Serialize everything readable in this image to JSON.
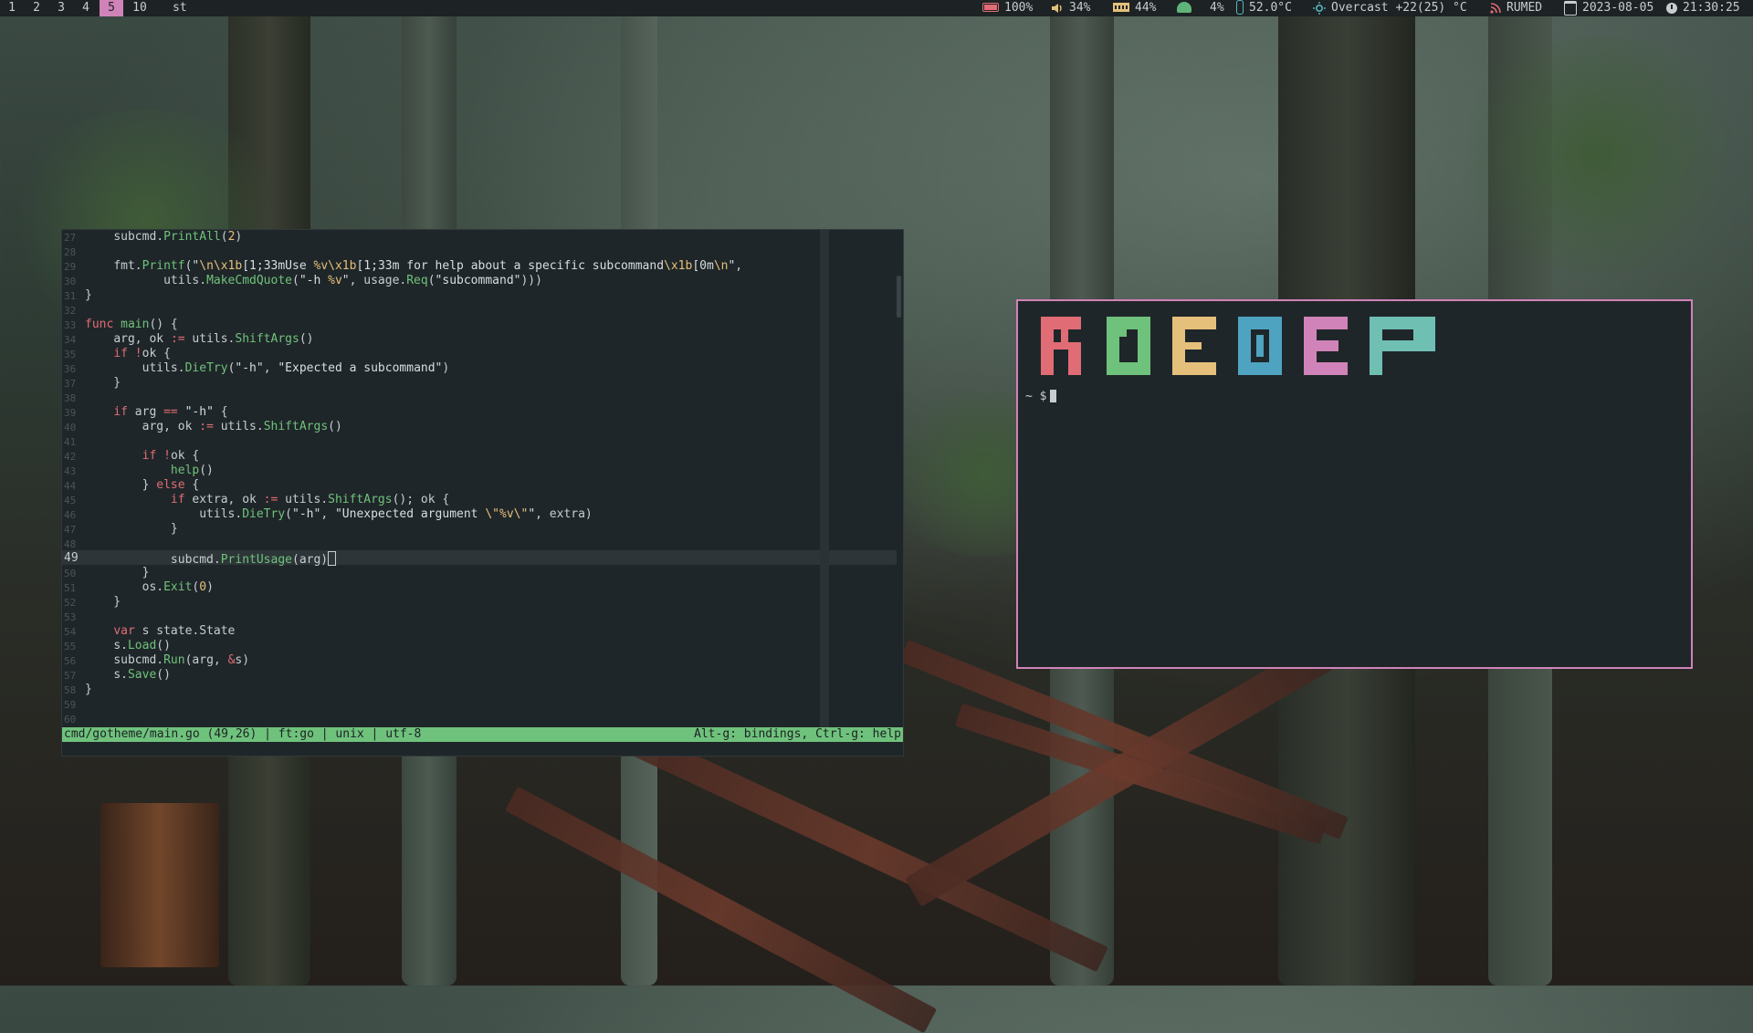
{
  "topbar": {
    "workspaces": [
      "1",
      "2",
      "3",
      "4",
      "5",
      "10"
    ],
    "active_workspace": "5",
    "window_title": "st",
    "battery": "100%",
    "volume": "34%",
    "memory": "44%",
    "cpu": "4%",
    "temperature": "52.0°C",
    "weather": "Overcast +22(25) °C",
    "rss": "RUMED",
    "date": "2023-08-05",
    "time": "21:30:25"
  },
  "editor": {
    "line_numbers": [
      "27",
      "28",
      "29",
      "30",
      "31",
      "32",
      "33",
      "34",
      "35",
      "36",
      "37",
      "38",
      "39",
      "40",
      "41",
      "42",
      "43",
      "44",
      "45",
      "46",
      "47",
      "48",
      "49",
      "50",
      "51",
      "52",
      "53",
      "54",
      "55",
      "56",
      "57",
      "58",
      "59",
      "60"
    ],
    "current_line": "49",
    "statusbar": {
      "left": "cmd/gotheme/main.go (49,26) | ft:go | unix | utf-8",
      "right": "Alt-g: bindings, Ctrl-g: help"
    }
  },
  "terminal": {
    "prompt": "~ $",
    "logo_colors": [
      "#e06c75",
      "#6fc27c",
      "#e5c07b",
      "#4ea3c0",
      "#d083b8",
      "#6fbfb2"
    ]
  },
  "colors": {
    "accent": "#d083b8",
    "status_green": "#6fc27c",
    "bg": "#1f2629",
    "bar_bg": "#1d2224"
  }
}
